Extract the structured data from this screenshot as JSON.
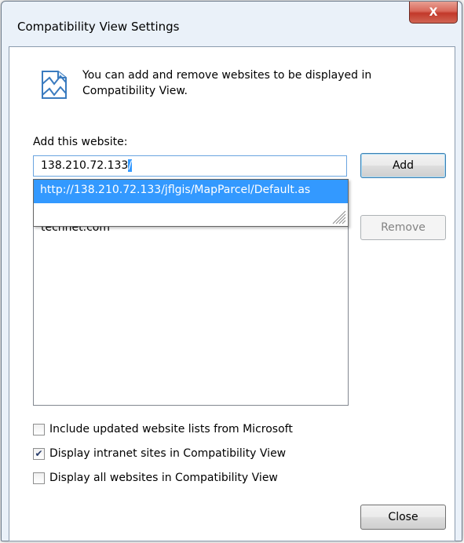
{
  "window": {
    "title": "Compatibility View Settings",
    "close_glyph": "X"
  },
  "info": {
    "icon": "compatibility-view-icon",
    "text": "You can add and remove websites to be displayed in Compatibility View."
  },
  "add_section": {
    "label": "Add this website:",
    "input_value_plain": "138.210.72.133",
    "input_value_selected": "/",
    "add_button": "Add"
  },
  "autocomplete": {
    "suggestion": "http://138.210.72.133/jflgis/MapParcel/Default.as"
  },
  "website_list": {
    "items": [
      "technet.com"
    ],
    "remove_button": "Remove"
  },
  "options": [
    {
      "label": "Include updated website lists from Microsoft",
      "checked": false
    },
    {
      "label": "Display intranet sites in Compatibility View",
      "checked": true
    },
    {
      "label": "Display all websites in Compatibility View",
      "checked": false
    }
  ],
  "footer": {
    "close_button": "Close"
  },
  "colors": {
    "selection": "#3399ff",
    "window_frame": "#eaf1f9",
    "close_button": "#c2392a"
  }
}
